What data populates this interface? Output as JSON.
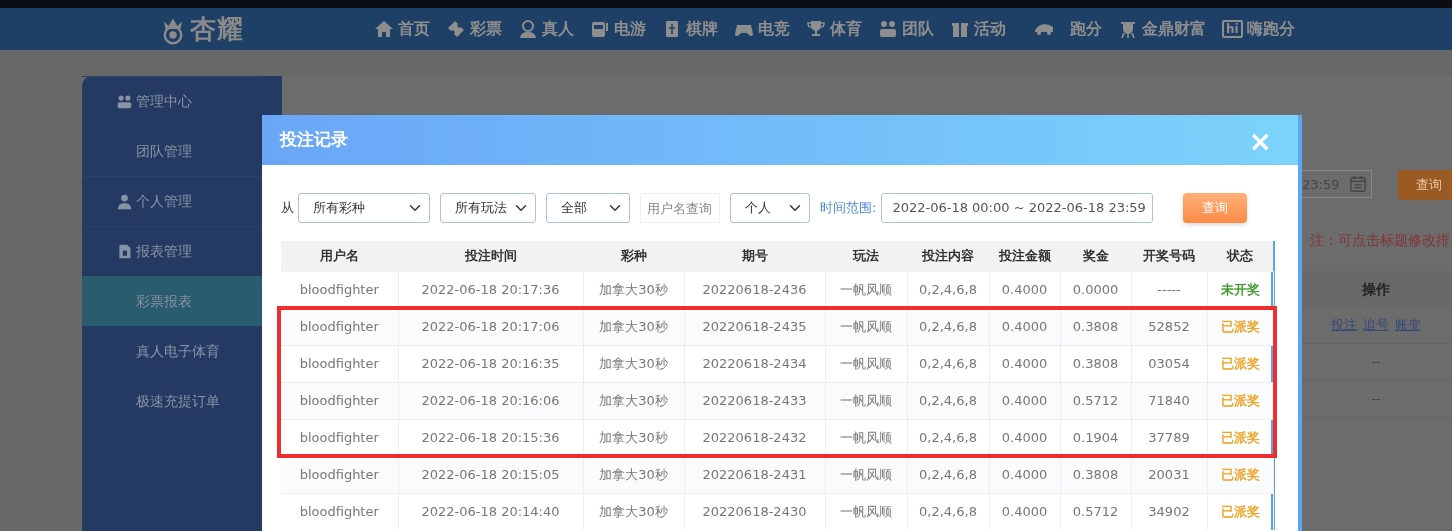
{
  "logo": {
    "text": "杏耀"
  },
  "nav": [
    {
      "label": "首页"
    },
    {
      "label": "彩票"
    },
    {
      "label": "真人"
    },
    {
      "label": "电游"
    },
    {
      "label": "棋牌"
    },
    {
      "label": "电竞"
    },
    {
      "label": "体育"
    },
    {
      "label": "团队"
    },
    {
      "label": "活动"
    },
    {
      "label": "跑分"
    },
    {
      "label": "金鼎财富"
    },
    {
      "label": "嗨跑分",
      "badge": "hi"
    }
  ],
  "sidebar": [
    {
      "label": "管理中心",
      "kind": "header",
      "children": [
        {
          "label": "团队管理",
          "selected": false
        }
      ]
    },
    {
      "label": "个人管理",
      "kind": "header"
    },
    {
      "label": "报表管理",
      "kind": "header",
      "children": [
        {
          "label": "彩票报表",
          "selected": true
        },
        {
          "label": "真人电子体育",
          "selected": false
        },
        {
          "label": "极速充提订单",
          "selected": false
        }
      ]
    }
  ],
  "page": {
    "date_value": "23:59",
    "search_button": "查询",
    "note": "注：可点击标题修改排",
    "table_header": "操作",
    "rows": [
      {
        "links": [
          "投注",
          "追号",
          "账变"
        ]
      },
      {
        "text": "--"
      },
      {
        "text": "--"
      }
    ]
  },
  "modal": {
    "title": "投注记录",
    "close": "×",
    "filters": {
      "from_label": "从",
      "lottery": "所有彩种",
      "play": "所有玩法",
      "scope": "全部",
      "username_placeholder": "用户名查询",
      "who": "个人",
      "range_label": "时间范围:",
      "range": "2022-06-18 00:00 ~ 2022-06-18 23:59",
      "search_button": "查询"
    },
    "table": {
      "columns": [
        "用户名",
        "投注时间",
        "彩种",
        "期号",
        "玩法",
        "投注内容",
        "投注金额",
        "奖金",
        "开奖号码",
        "状态"
      ],
      "row_groups": [
        {
          "highlighted": false,
          "rows": [
            {
              "cells": [
                "bloodfighter",
                "2022-06-18 20:17:36",
                "加拿大30秒",
                "20220618-2436",
                "一帆风顺",
                "0,2,4,6,8",
                "0.4000",
                "0.0000",
                "-----",
                "未开奖"
              ],
              "color": "#3a9a2a"
            }
          ]
        },
        {
          "highlighted": true,
          "rows": [
            {
              "cells": [
                "bloodfighter",
                "2022-06-18 20:17:06",
                "加拿大30秒",
                "20220618-2435",
                "一帆风顺",
                "0,2,4,6,8",
                "0.4000",
                "0.3808",
                "52852",
                "已派奖"
              ],
              "color": "#f0a020"
            },
            {
              "cells": [
                "bloodfighter",
                "2022-06-18 20:16:35",
                "加拿大30秒",
                "20220618-2434",
                "一帆风顺",
                "0,2,4,6,8",
                "0.4000",
                "0.3808",
                "03054",
                "已派奖"
              ],
              "color": "#f0a020"
            },
            {
              "cells": [
                "bloodfighter",
                "2022-06-18 20:16:06",
                "加拿大30秒",
                "20220618-2433",
                "一帆风顺",
                "0,2,4,6,8",
                "0.4000",
                "0.5712",
                "71840",
                "已派奖"
              ],
              "color": "#f0a020"
            },
            {
              "cells": [
                "bloodfighter",
                "2022-06-18 20:15:36",
                "加拿大30秒",
                "20220618-2432",
                "一帆风顺",
                "0,2,4,6,8",
                "0.4000",
                "0.1904",
                "37789",
                "已派奖"
              ],
              "color": "#f0a020"
            }
          ]
        },
        {
          "highlighted": false,
          "rows": [
            {
              "cells": [
                "bloodfighter",
                "2022-06-18 20:15:05",
                "加拿大30秒",
                "20220618-2431",
                "一帆风顺",
                "0,2,4,6,8",
                "0.4000",
                "0.3808",
                "20031",
                "已派奖"
              ],
              "color": "#f0a020"
            },
            {
              "cells": [
                "bloodfighter",
                "2022-06-18 20:14:40",
                "加拿大30秒",
                "20220618-2430",
                "一帆风顺",
                "0,2,4,6,8",
                "0.4000",
                "0.5712",
                "34902",
                "已派奖"
              ],
              "color": "#f0a020"
            }
          ]
        }
      ]
    }
  }
}
